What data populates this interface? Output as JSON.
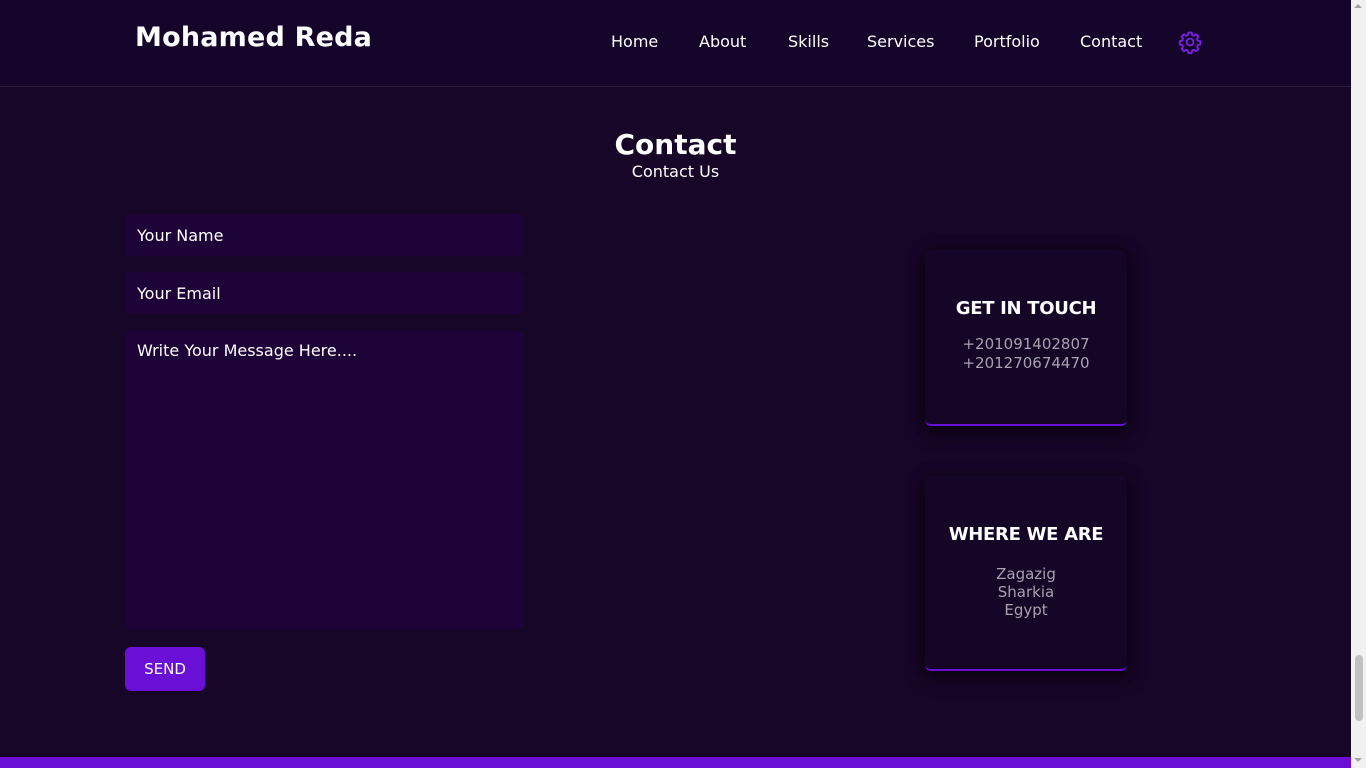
{
  "header": {
    "brand": "Mohamed Reda",
    "nav": [
      "Home",
      "About",
      "Skills",
      "Services",
      "Portfolio",
      "Contact"
    ],
    "settings_icon": "gear-icon"
  },
  "section": {
    "title": "Contact",
    "subtitle": "Contact Us"
  },
  "form": {
    "name_placeholder": "Your Name",
    "email_placeholder": "Your Email",
    "message_placeholder": "Write Your Message Here....",
    "send_label": "SEND"
  },
  "cards": {
    "touch": {
      "title": "GET IN TOUCH",
      "lines": [
        "+201091402807",
        "+201270674470"
      ]
    },
    "where": {
      "title": "WHERE WE ARE",
      "lines": [
        "Zagazig",
        "Sharkia",
        "Egypt"
      ]
    }
  },
  "colors": {
    "background": "#170627",
    "header": "#15052a",
    "field": "#1e0338",
    "accent": "#6a0fd6",
    "muted_text": "#a7a1b0"
  }
}
